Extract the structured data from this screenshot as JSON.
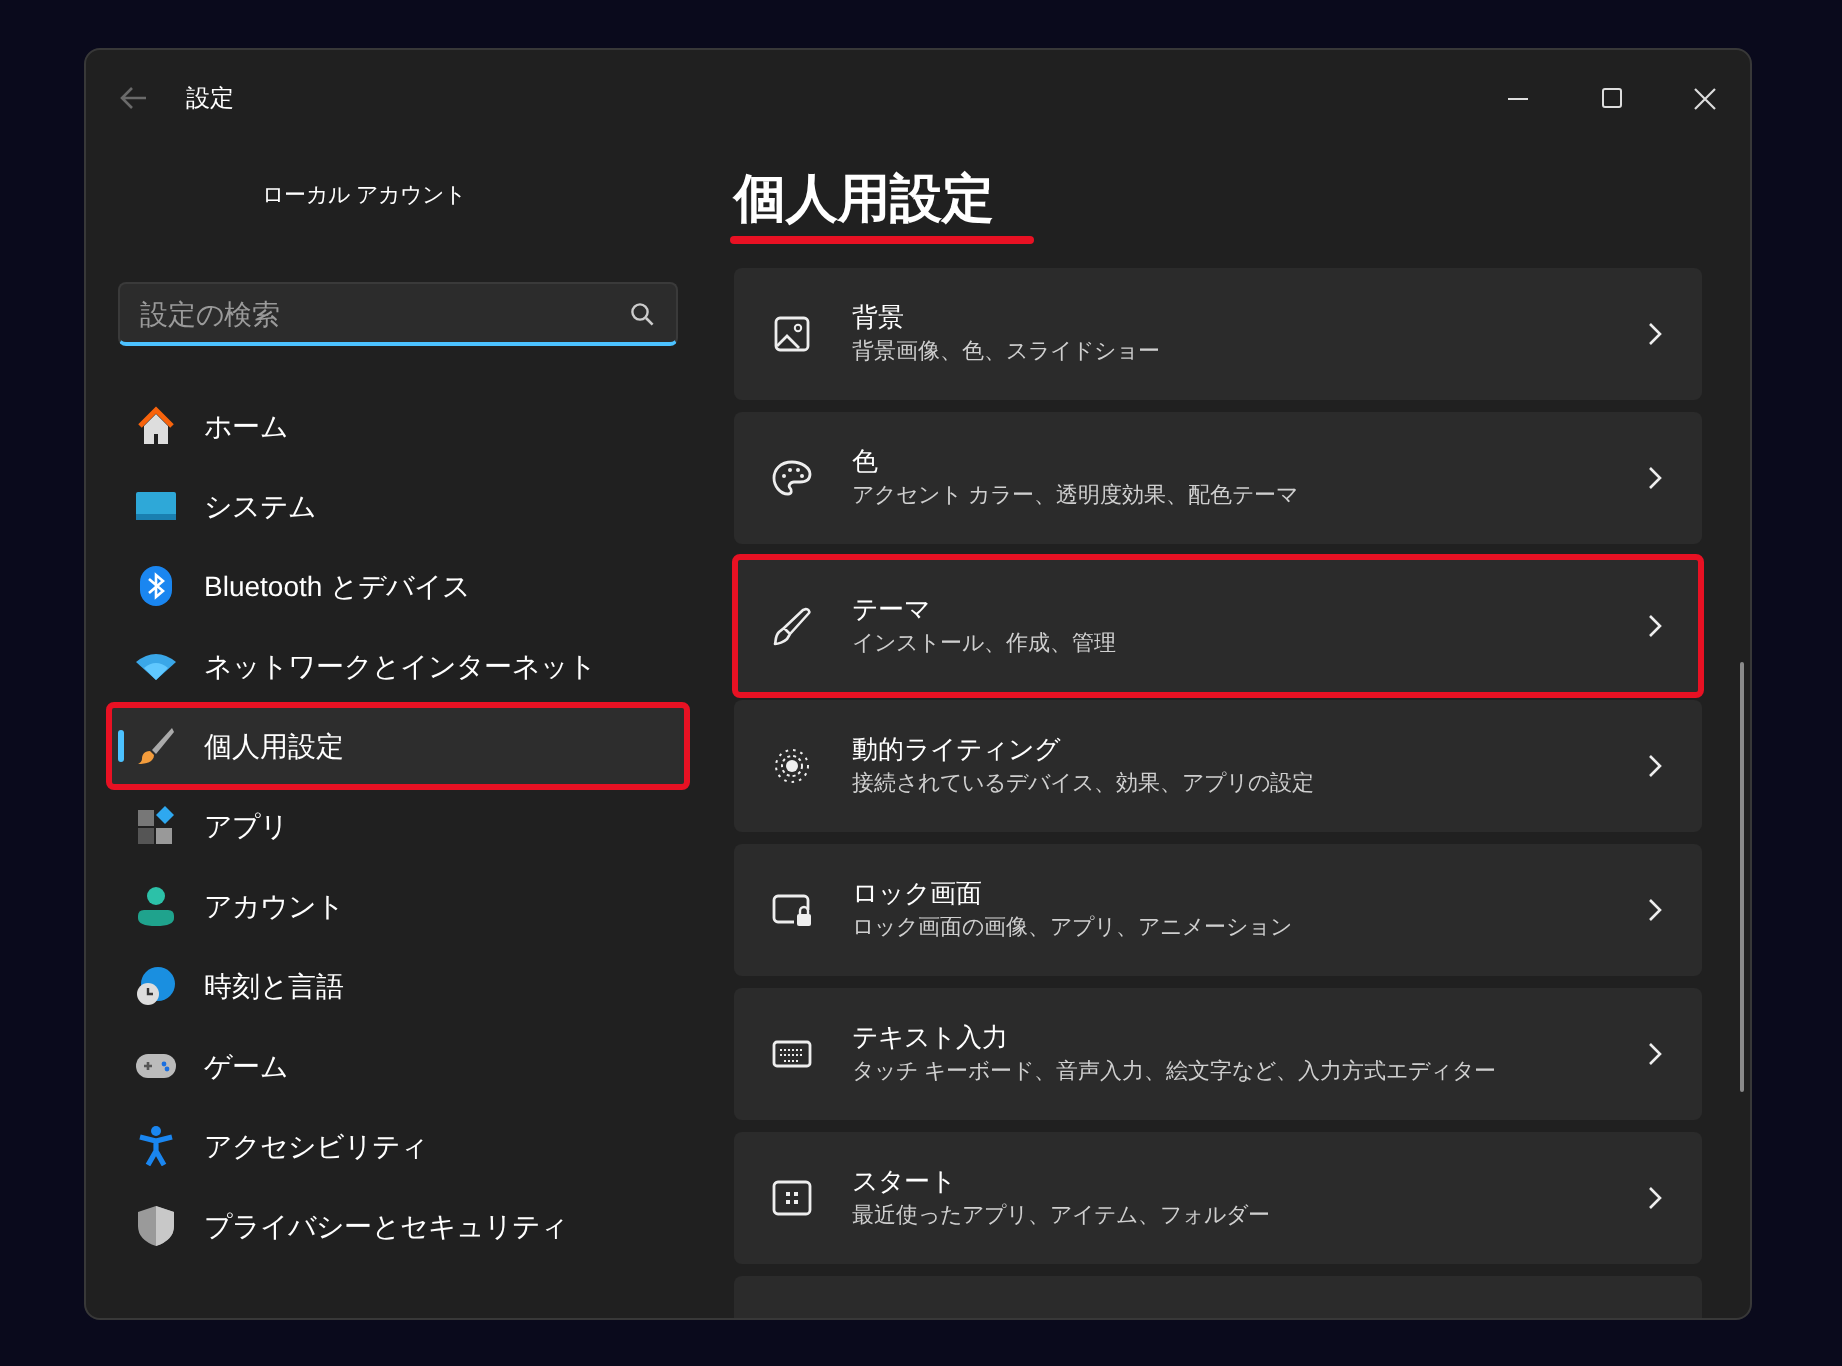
{
  "window": {
    "title": "設定"
  },
  "account": {
    "name": "ローカル アカウント"
  },
  "search": {
    "placeholder": "設定の検索"
  },
  "sidebar": {
    "items": [
      {
        "label": "ホーム",
        "selected": false,
        "highlighted": false
      },
      {
        "label": "システム",
        "selected": false,
        "highlighted": false
      },
      {
        "label": "Bluetooth とデバイス",
        "selected": false,
        "highlighted": false
      },
      {
        "label": "ネットワークとインターネット",
        "selected": false,
        "highlighted": false
      },
      {
        "label": "個人用設定",
        "selected": true,
        "highlighted": true
      },
      {
        "label": "アプリ",
        "selected": false,
        "highlighted": false
      },
      {
        "label": "アカウント",
        "selected": false,
        "highlighted": false
      },
      {
        "label": "時刻と言語",
        "selected": false,
        "highlighted": false
      },
      {
        "label": "ゲーム",
        "selected": false,
        "highlighted": false
      },
      {
        "label": "アクセシビリティ",
        "selected": false,
        "highlighted": false
      },
      {
        "label": "プライバシーとセキュリティ",
        "selected": false,
        "highlighted": false
      }
    ]
  },
  "page": {
    "heading": "個人用設定",
    "heading_underlined": true,
    "cards": [
      {
        "title": "背景",
        "subtitle": "背景画像、色、スライドショー",
        "highlighted": false
      },
      {
        "title": "色",
        "subtitle": "アクセント カラー、透明度効果、配色テーマ",
        "highlighted": false
      },
      {
        "title": "テーマ",
        "subtitle": "インストール、作成、管理",
        "highlighted": true
      },
      {
        "title": "動的ライティング",
        "subtitle": "接続されているデバイス、効果、アプリの設定",
        "highlighted": false
      },
      {
        "title": "ロック画面",
        "subtitle": "ロック画面の画像、アプリ、アニメーション",
        "highlighted": false
      },
      {
        "title": "テキスト入力",
        "subtitle": "タッチ キーボード、音声入力、絵文字など、入力方式エディター",
        "highlighted": false
      },
      {
        "title": "スタート",
        "subtitle": "最近使ったアプリ、アイテム、フォルダー",
        "highlighted": false
      },
      {
        "highlighted": false
      }
    ]
  }
}
